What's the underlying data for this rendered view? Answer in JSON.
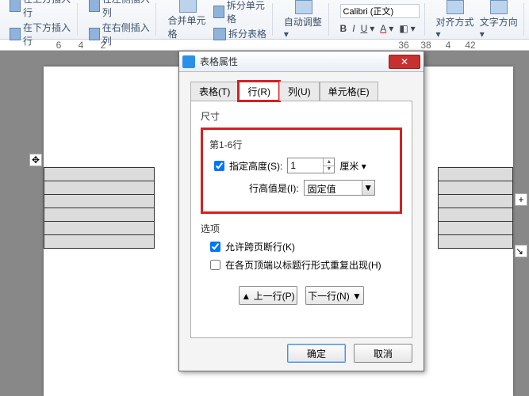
{
  "ribbon": {
    "insert_row_above": "在上方插入行",
    "insert_row_below": "在下方插入行",
    "insert_col_left": "在左侧插入列",
    "insert_col_right": "在右侧插入列",
    "merge_cells": "合并单元格",
    "split_cells": "拆分单元格",
    "split_table": "拆分表格",
    "auto_fit": "自动调整",
    "font_name": "Calibri (正文)",
    "align": "对齐方式",
    "text_dir": "文字方向"
  },
  "ruler": {
    "left": [
      "6",
      "4",
      "2"
    ],
    "right": [
      "36",
      "38",
      "4",
      "42"
    ]
  },
  "dialog": {
    "title": "表格属性",
    "tabs": {
      "table": "表格(T)",
      "row": "行(R)",
      "col": "列(U)",
      "cell": "单元格(E)"
    },
    "size_label": "尺寸",
    "rows_label": "第1-6行",
    "spec_height_label": "指定高度(S):",
    "height_value": "1",
    "unit": "厘米",
    "row_height_is_label": "行高值是(I):",
    "row_height_is_value": "固定值",
    "options_label": "选项",
    "allow_break": "允许跨页断行(K)",
    "repeat_header": "在各页顶端以标题行形式重复出现(H)",
    "prev": "▲ 上一行(P)",
    "next": "下一行(N) ▼",
    "ok": "确定",
    "cancel": "取消"
  }
}
